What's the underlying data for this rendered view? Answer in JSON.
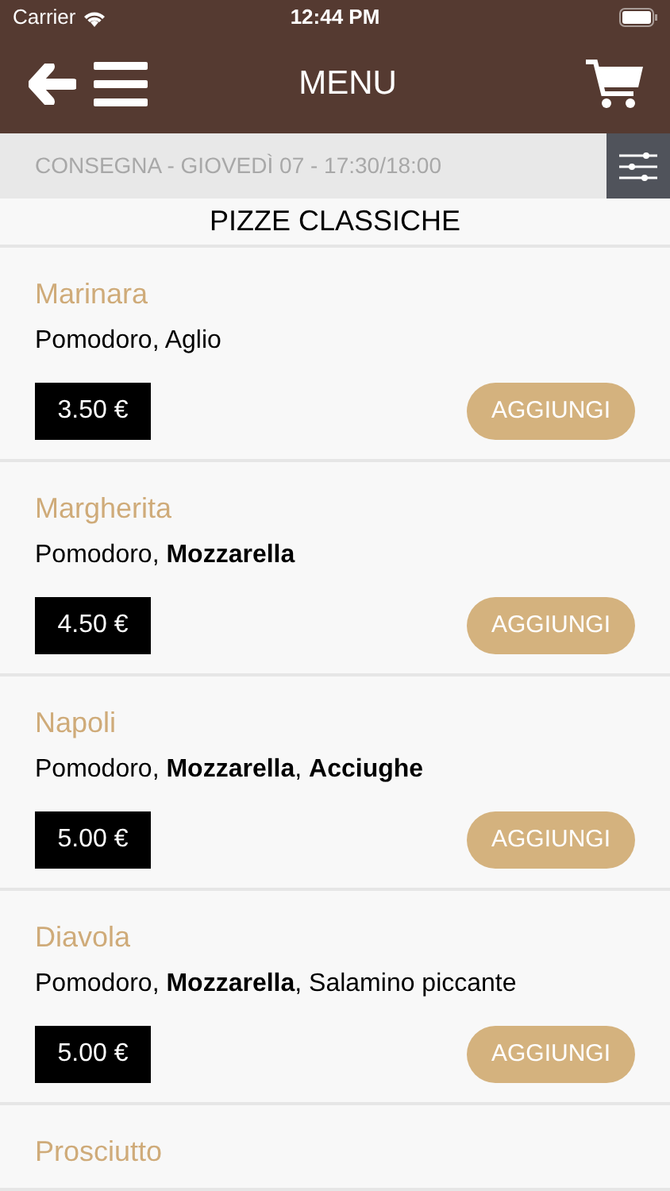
{
  "status_bar": {
    "carrier": "Carrier",
    "time": "12:44 PM"
  },
  "header": {
    "title": "MENU"
  },
  "delivery": {
    "text": "CONSEGNA - GIOVEDÌ 07 - 17:30/18:00"
  },
  "section": {
    "title": "PIZZE CLASSICHE"
  },
  "items": [
    {
      "name": "Marinara",
      "ingredients": "Pomodoro, Aglio",
      "price": "3.50 €",
      "button": "AGGIUNGI"
    },
    {
      "name": "Margherita",
      "ingredients": "Pomodoro, **Mozzarella**",
      "price": "4.50 €",
      "button": "AGGIUNGI"
    },
    {
      "name": "Napoli",
      "ingredients": "Pomodoro, **Mozzarella**, **Acciughe**",
      "price": "5.00 €",
      "button": "AGGIUNGI"
    },
    {
      "name": "Diavola",
      "ingredients": "Pomodoro, **Mozzarella**, Salamino piccante",
      "price": "5.00 €",
      "button": "AGGIUNGI"
    },
    {
      "name": "Prosciutto"
    }
  ]
}
